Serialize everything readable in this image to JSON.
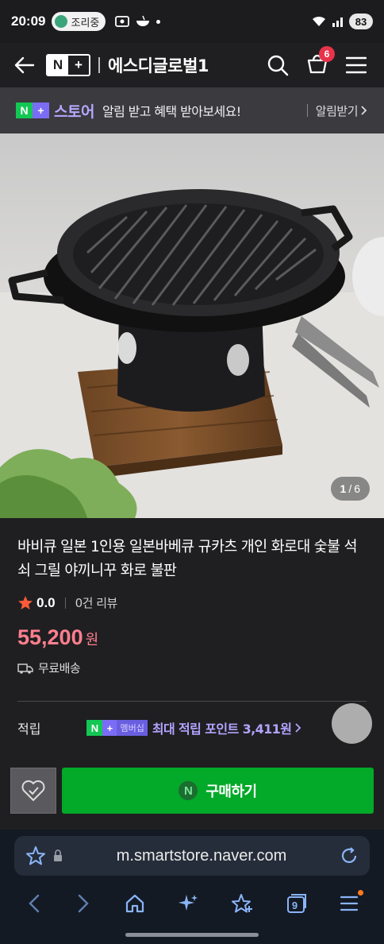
{
  "status_bar": {
    "time": "20:09",
    "activity": "조리중",
    "battery": "83",
    "icons": [
      "camera-scan-icon",
      "bowl-icon",
      "wifi-icon",
      "signal-icon"
    ]
  },
  "header": {
    "logo_n": "N",
    "logo_plus": "+",
    "store_name": "에스디글로벌1",
    "cart_count": "6",
    "icons": [
      "back-arrow-icon",
      "search-icon",
      "cart-icon",
      "menu-icon"
    ]
  },
  "notice": {
    "brand_n": "N",
    "brand_plus": "+",
    "brand_text": "스토어",
    "message": "알림 받고 혜택 받아보세요!",
    "link_label": "알림받기"
  },
  "gallery": {
    "current": "1",
    "separator": "/",
    "total": "6"
  },
  "product": {
    "title": "바비큐 일본 1인용 일본바베큐 규카츠 개인 화로대 숯불 석쇠 그릴 야끼니꾸 화로 불판",
    "rating": "0.0",
    "review_count": "0건 리뷰",
    "price": "55,200",
    "price_unit": "원",
    "shipping": "무료배송"
  },
  "points": {
    "label": "적립",
    "badge_n": "N",
    "badge_plus": "+",
    "badge_member": "멤버십",
    "text": "최대 적립 포인트 3,411원"
  },
  "buy_bar": {
    "buy_icon_letter": "N",
    "buy_label": "구매하기"
  },
  "browser": {
    "url": "m.smartstore.naver.com",
    "tab_count": "9"
  },
  "colors": {
    "accent_green": "#03a928",
    "price_pink": "#ff7f8e",
    "points_purple": "#b2a3ff",
    "cart_badge": "#e8334a"
  }
}
